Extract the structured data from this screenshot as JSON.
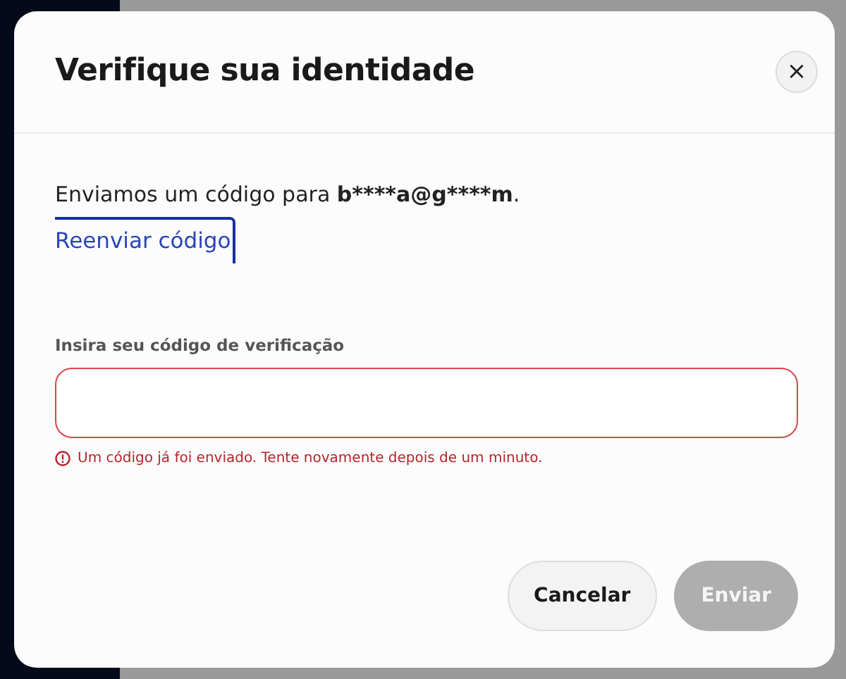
{
  "dialog": {
    "title": "Verifique sua identidade",
    "close": "×"
  },
  "message": {
    "text": "Enviamos um código para",
    "masked_email": "b****a@g****m",
    "end": "."
  },
  "resend_link": "Reenviar código",
  "code_field": {
    "label": "Insira seu código de verificação",
    "invalid": true,
    "error": "Um código já foi enviado. Tente novamente depois de um minuto."
  },
  "buttons": [
    {
      "label": "Cancelar",
      "kind": "secondary",
      "disabled": false
    },
    {
      "label": "Enviar",
      "kind": "primary",
      "disabled": true
    }
  ]
}
